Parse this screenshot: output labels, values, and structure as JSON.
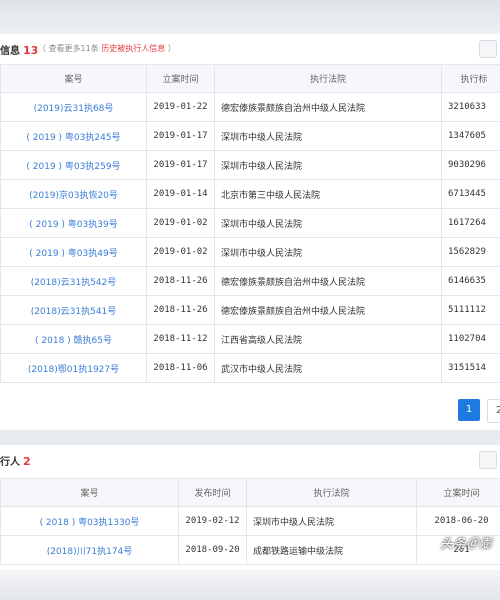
{
  "section1": {
    "title": "信息",
    "count": "13",
    "note_prefix": "（ 查看更多11条 ",
    "note_link": "历史被执行人信息",
    "note_suffix": " ）",
    "columns": [
      "案号",
      "立案时间",
      "执行法院",
      "执行标"
    ],
    "rows": [
      {
        "case": "(2019)云31执68号",
        "date": "2019-01-22",
        "court": "德宏傣族景颇族自治州中级人民法院",
        "amount": "3210633"
      },
      {
        "case": "( 2019 ) 粤03执245号",
        "date": "2019-01-17",
        "court": "深圳市中级人民法院",
        "amount": "1347605"
      },
      {
        "case": "( 2019 ) 粤03执259号",
        "date": "2019-01-17",
        "court": "深圳市中级人民法院",
        "amount": "9030296"
      },
      {
        "case": "(2019)京03执恢20号",
        "date": "2019-01-14",
        "court": "北京市第三中级人民法院",
        "amount": "6713445"
      },
      {
        "case": "( 2019 ) 粤03执39号",
        "date": "2019-01-02",
        "court": "深圳市中级人民法院",
        "amount": "1617264"
      },
      {
        "case": "( 2019 ) 粤03执49号",
        "date": "2019-01-02",
        "court": "深圳市中级人民法院",
        "amount": "1562829"
      },
      {
        "case": "(2018)云31执542号",
        "date": "2018-11-26",
        "court": "德宏傣族景颇族自治州中级人民法院",
        "amount": "6146635"
      },
      {
        "case": "(2018)云31执541号",
        "date": "2018-11-26",
        "court": "德宏傣族景颇族自治州中级人民法院",
        "amount": "5111112"
      },
      {
        "case": "( 2018 ) 赣执65号",
        "date": "2018-11-12",
        "court": "江西省高级人民法院",
        "amount": "1102704"
      },
      {
        "case": "(2018)鄂01执1927号",
        "date": "2018-11-06",
        "court": "武汉市中级人民法院",
        "amount": "3151514"
      }
    ],
    "pagination": {
      "current": "1",
      "next": "2"
    }
  },
  "section2": {
    "title": "行人",
    "count": "2",
    "columns": [
      "案号",
      "发布时间",
      "执行法院",
      "立案时间"
    ],
    "rows": [
      {
        "case": "( 2018 ) 粤03执1330号",
        "publish": "2019-02-12",
        "court": "深圳市中级人民法院",
        "filed": "2018-06-20"
      },
      {
        "case": "(2018)川71执174号",
        "publish": "2018-09-20",
        "court": "成都铁路运输中级法院",
        "filed": "201"
      }
    ]
  },
  "watermark": "头条＠澎"
}
